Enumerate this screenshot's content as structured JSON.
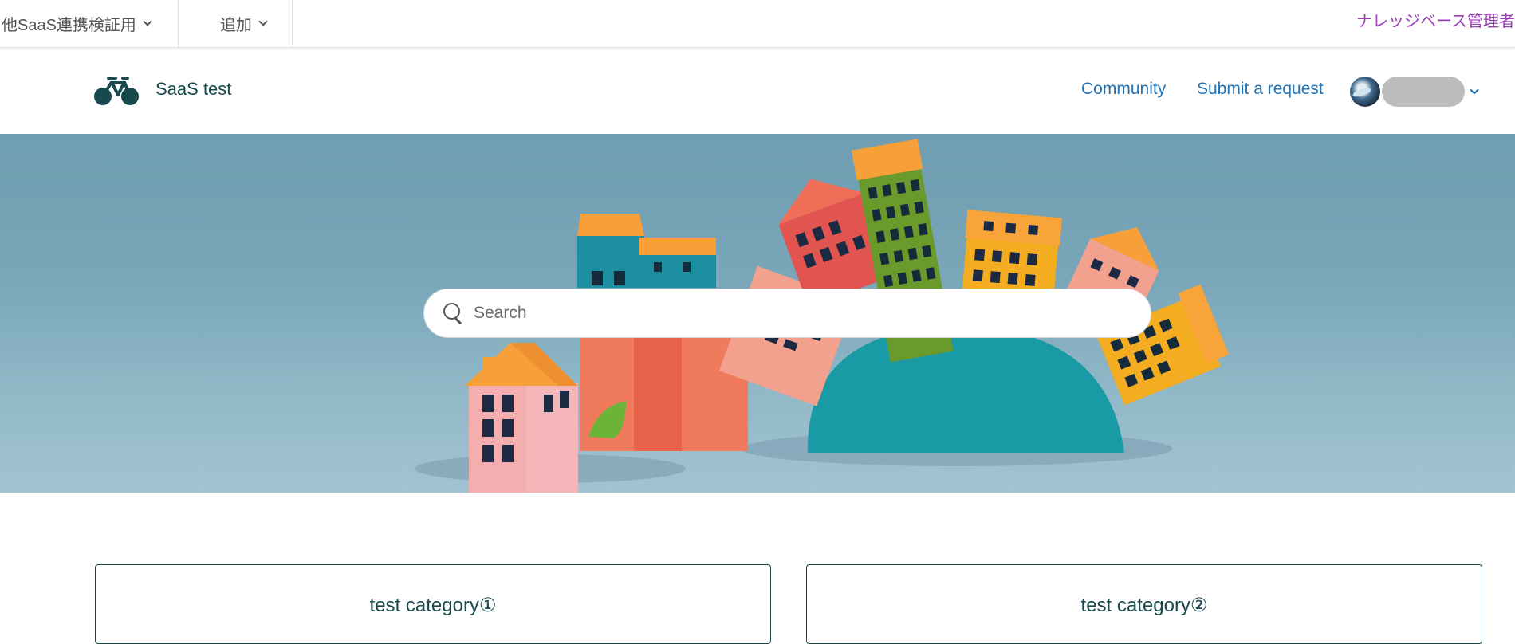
{
  "admin_bar": {
    "workspace_label": "他SaaS連携検証用",
    "add_label": "追加",
    "role_label": "ナレッジベース管理者",
    "role_color": "#9b3fb5"
  },
  "header": {
    "brand_name": "SaaS test",
    "nav": {
      "community": "Community",
      "submit_request": "Submit a request"
    },
    "link_color": "#1f73b7"
  },
  "search": {
    "placeholder": "Search"
  },
  "categories": [
    {
      "title": "test category①"
    },
    {
      "title": "test category②"
    }
  ],
  "icons": {
    "logo": "bicycle-logo-icon",
    "search": "search-icon",
    "chevron": "chevron-down-icon"
  }
}
